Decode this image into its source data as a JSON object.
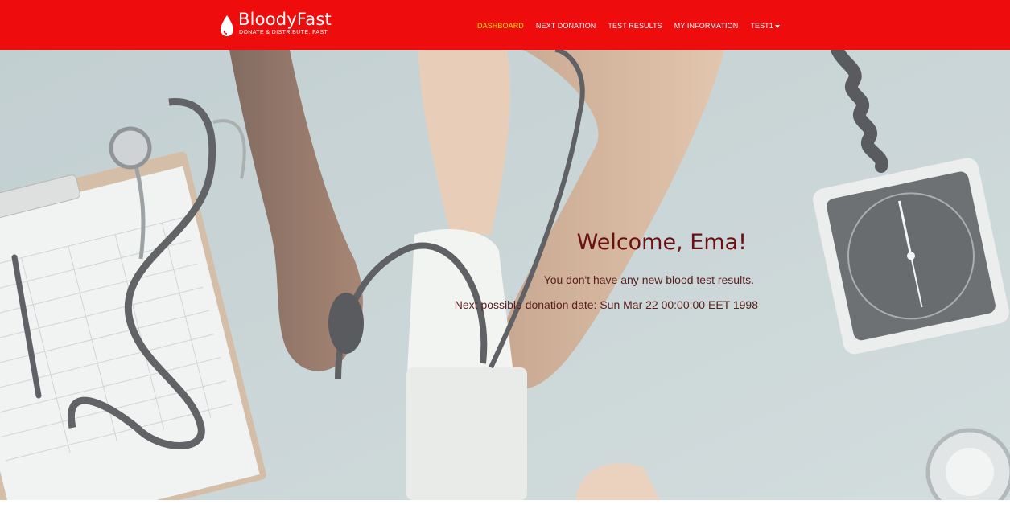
{
  "brand": {
    "name": "BloodyFast",
    "tagline": "DONATE & DISTRIBUTE. FAST.",
    "logo_icon": "blood-drop-icon"
  },
  "nav": {
    "items": [
      {
        "label": "DASHBOARD",
        "active": true
      },
      {
        "label": "NEXT DONATION",
        "active": false
      },
      {
        "label": "TEST RESULTS",
        "active": false
      },
      {
        "label": "MY INFORMATION",
        "active": false
      },
      {
        "label": "TEST1",
        "active": false,
        "dropdown": true
      }
    ]
  },
  "hero": {
    "welcome": "Welcome, Ema!",
    "message_results": "You don't have any new blood test results.",
    "message_donation": "Next possible donation date: Sun Mar 22 00:00:00 EET 1998",
    "background": "medical-checkup-photo"
  },
  "colors": {
    "navbar": "#ee0c0c",
    "active_nav": "#ffe600",
    "welcome_text": "#6b0f12"
  }
}
